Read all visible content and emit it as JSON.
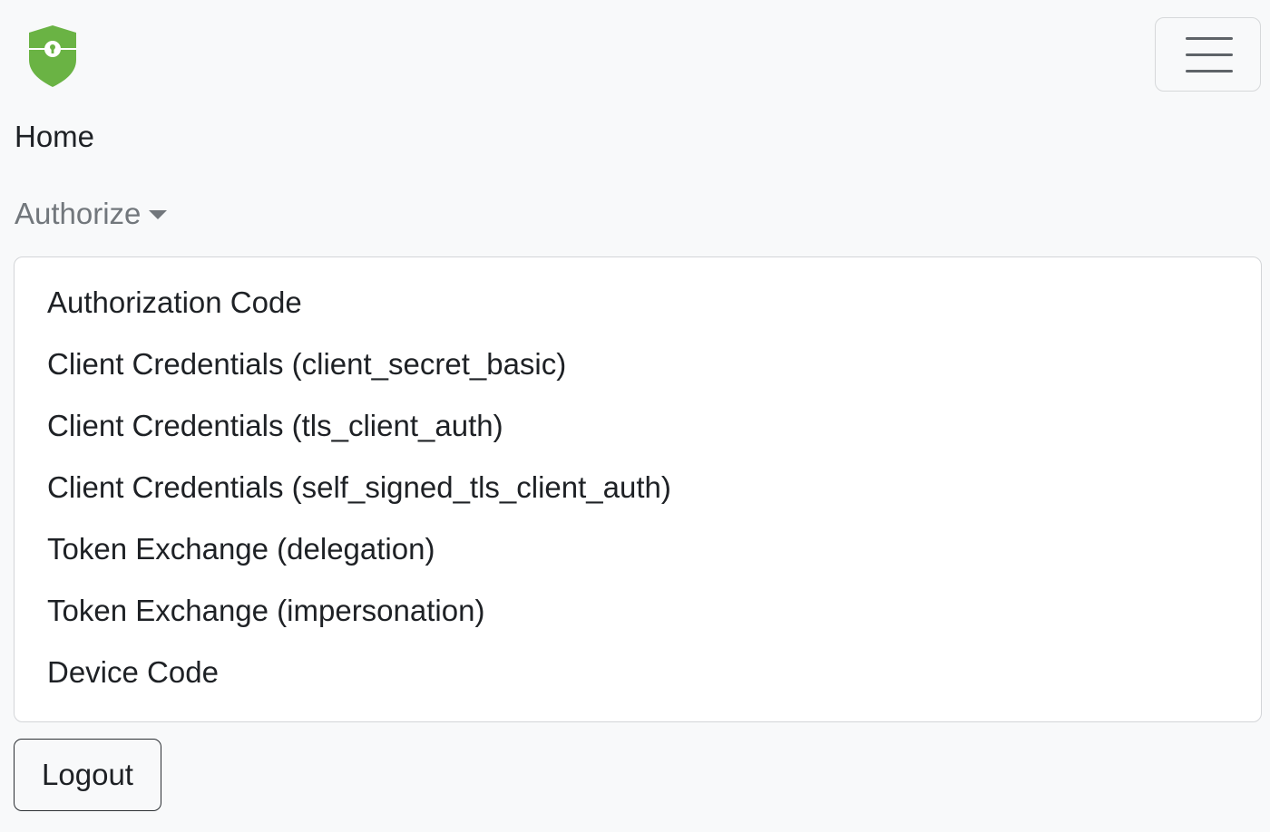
{
  "brand": {
    "icon": "shield-keyhole-icon",
    "color": "#6ab344"
  },
  "navbar": {
    "toggler_icon": "hamburger-menu-icon",
    "home_label": "Home",
    "authorize_label": "Authorize",
    "authorize_caret_icon": "caret-down-icon"
  },
  "dropdown": {
    "items": [
      {
        "label": "Authorization Code"
      },
      {
        "label": "Client Credentials (client_secret_basic)"
      },
      {
        "label": "Client Credentials (tls_client_auth)"
      },
      {
        "label": "Client Credentials (self_signed_tls_client_auth)"
      },
      {
        "label": "Token Exchange (delegation)"
      },
      {
        "label": "Token Exchange (impersonation)"
      },
      {
        "label": "Device Code"
      }
    ]
  },
  "actions": {
    "logout_label": "Logout"
  }
}
